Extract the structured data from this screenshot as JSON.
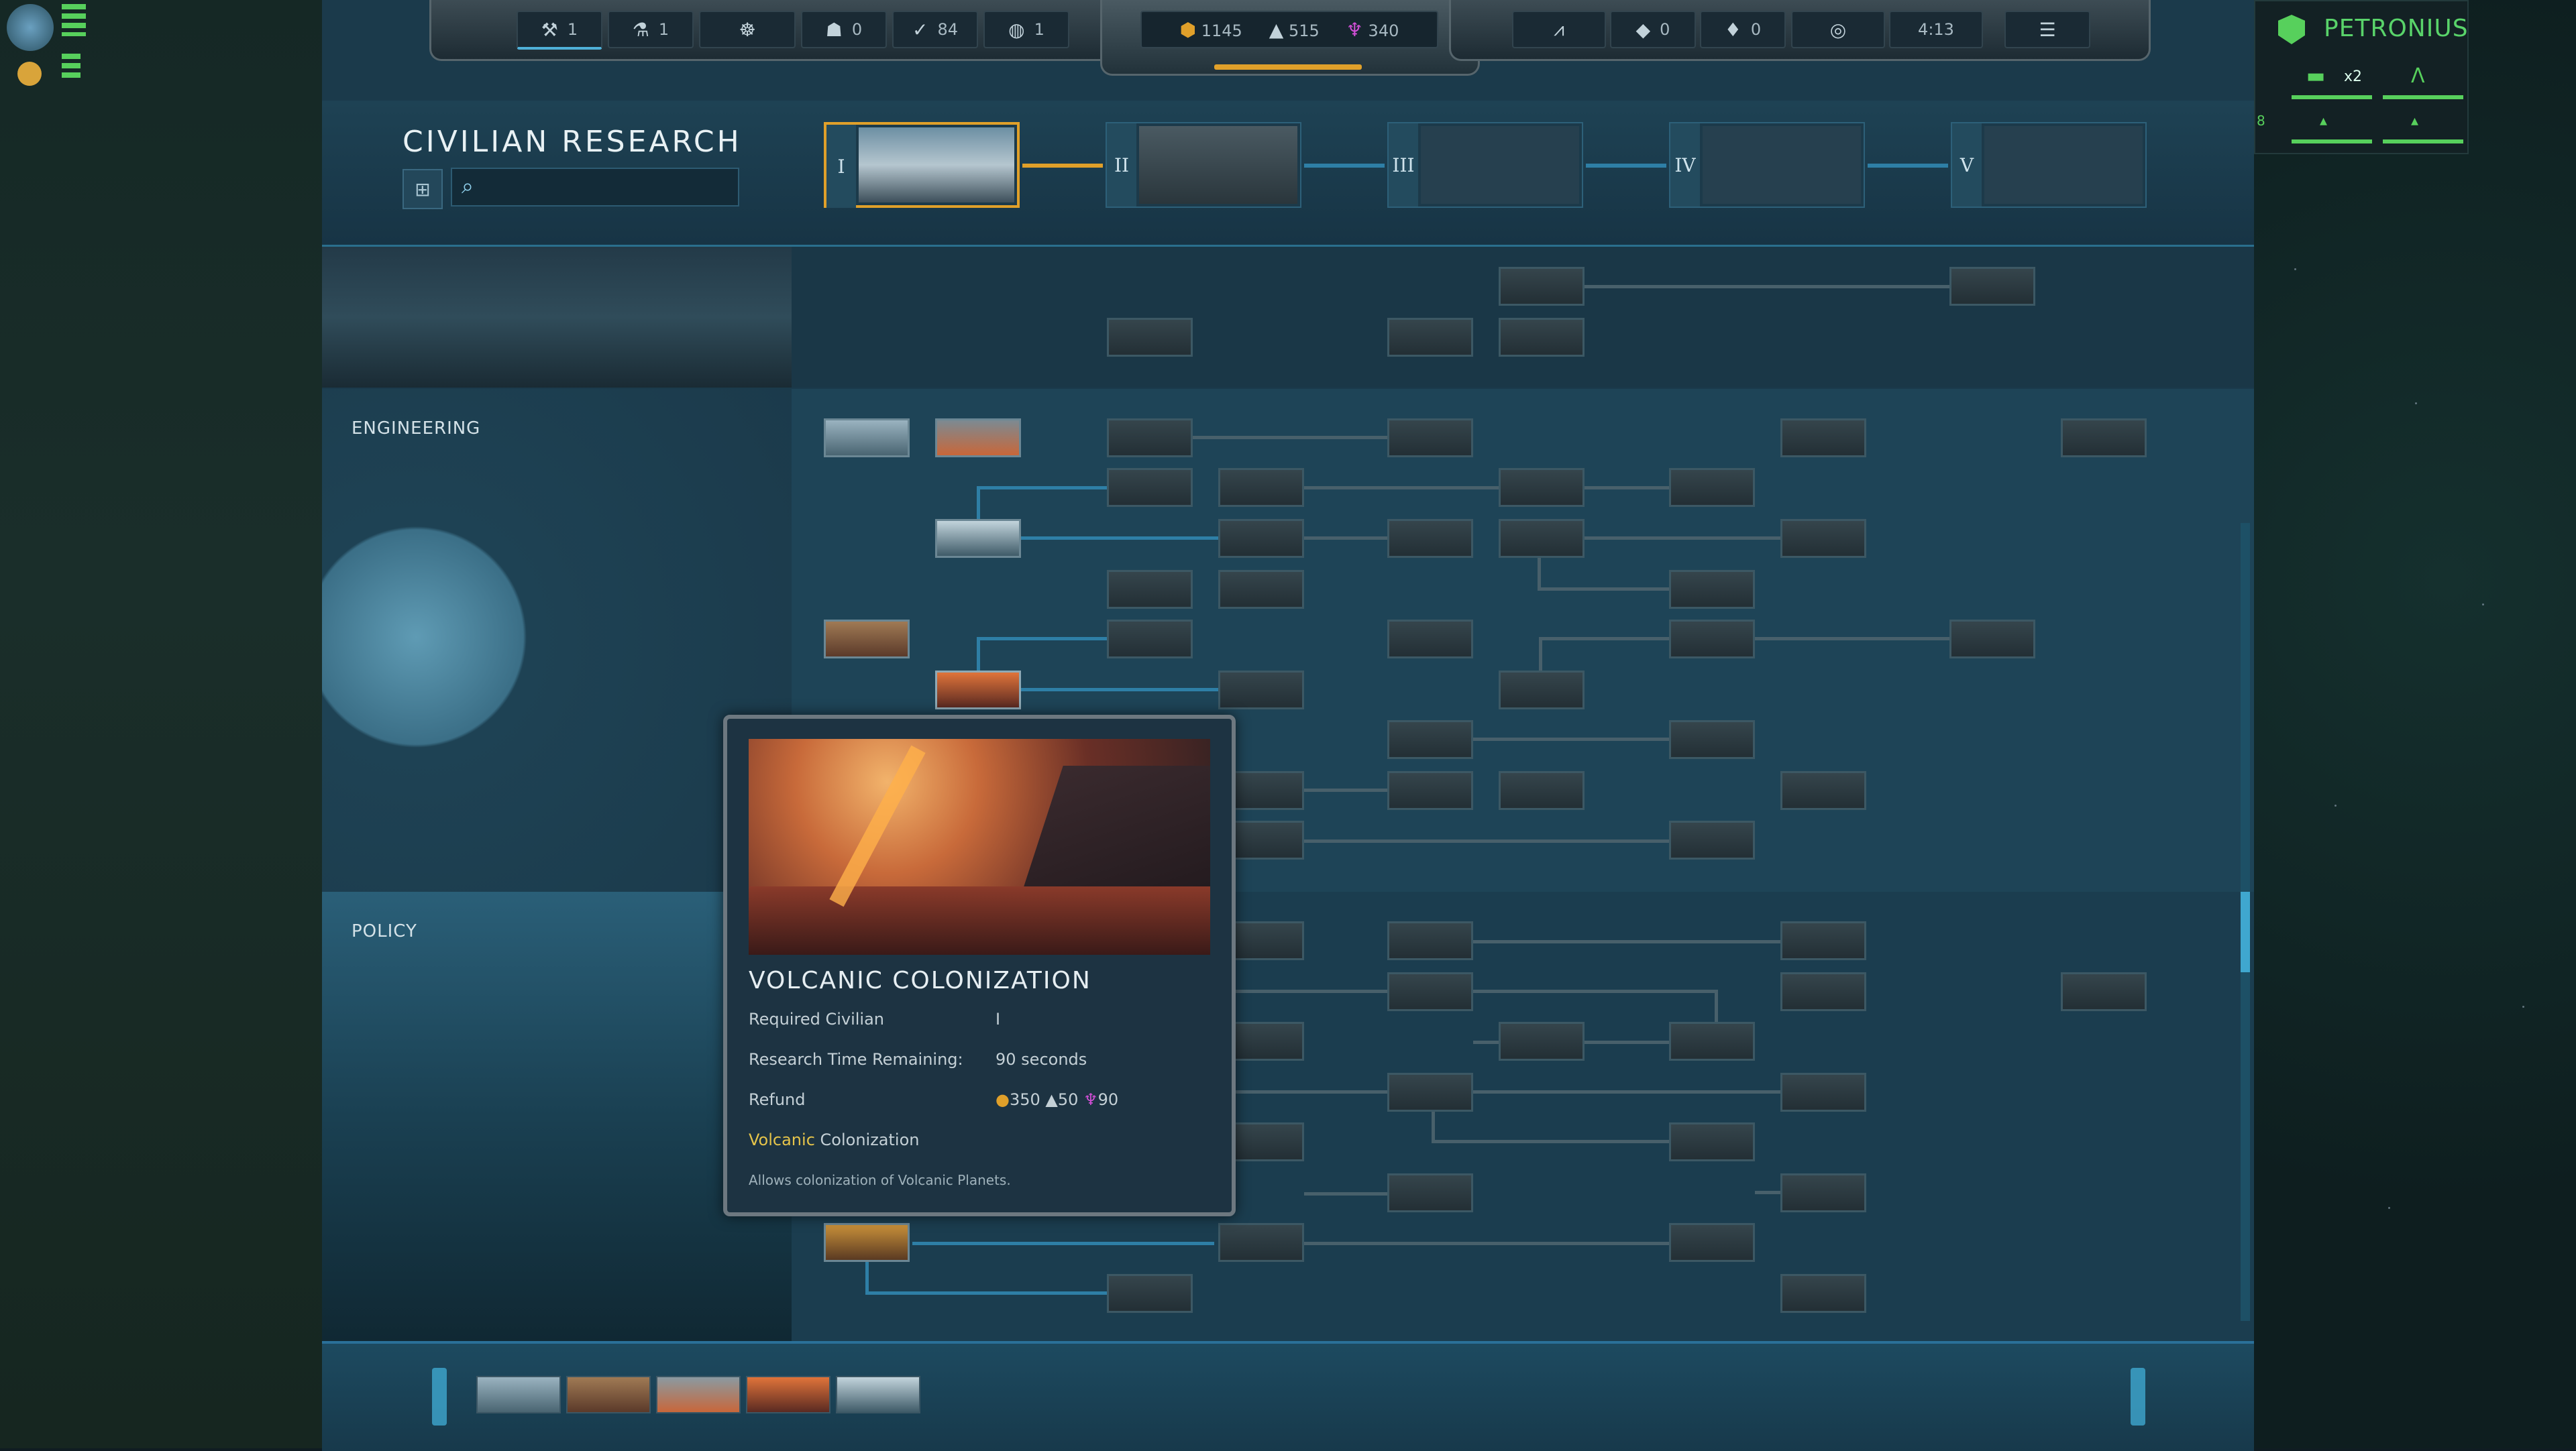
{
  "hud": {
    "slots": [
      {
        "icon": "builder-icon",
        "value": "1"
      },
      {
        "icon": "scientist-icon",
        "value": "1"
      },
      {
        "icon": "alien-icon",
        "value": ""
      },
      {
        "icon": "population-icon",
        "value": "0"
      },
      {
        "icon": "combat-icon",
        "value": "84"
      },
      {
        "icon": "planet-icon",
        "value": "1"
      }
    ],
    "resources": {
      "credits": "1145",
      "minerals": "515",
      "crystals": "340"
    },
    "right_slots": [
      {
        "icon": "stats-icon",
        "value": ""
      },
      {
        "icon": "cube-icon",
        "value": "0"
      },
      {
        "icon": "gem-icon",
        "value": "0"
      },
      {
        "icon": "target-icon",
        "value": ""
      }
    ],
    "timer": "4:13",
    "menu_icon": "menu-icon"
  },
  "research": {
    "title": "CIVILIAN RESEARCH",
    "search_placeholder": "",
    "tiers": [
      "I",
      "II",
      "III",
      "IV",
      "V"
    ],
    "sections": [
      "ENGINEERING",
      "POLICY"
    ]
  },
  "tooltip": {
    "name": "VOLCANIC COLONIZATION",
    "required_label": "Required Civilian",
    "required_value": "I",
    "time_label": "Research Time Remaining:",
    "time_value": "90 seconds",
    "refund_label": "Refund",
    "refund_credits": "350",
    "refund_minerals": "50",
    "refund_crystals": "90",
    "unlock_highlight": "Volcanic",
    "unlock_rest": " Colonization",
    "description": "Allows colonization of Volcanic Planets."
  },
  "faction": {
    "name": "PETRONIUS",
    "unit_count": "x2",
    "side_number": "8"
  },
  "colors": {
    "accent": "#e0a02a",
    "link": "#2e7fa6",
    "faction": "#57d05c"
  }
}
